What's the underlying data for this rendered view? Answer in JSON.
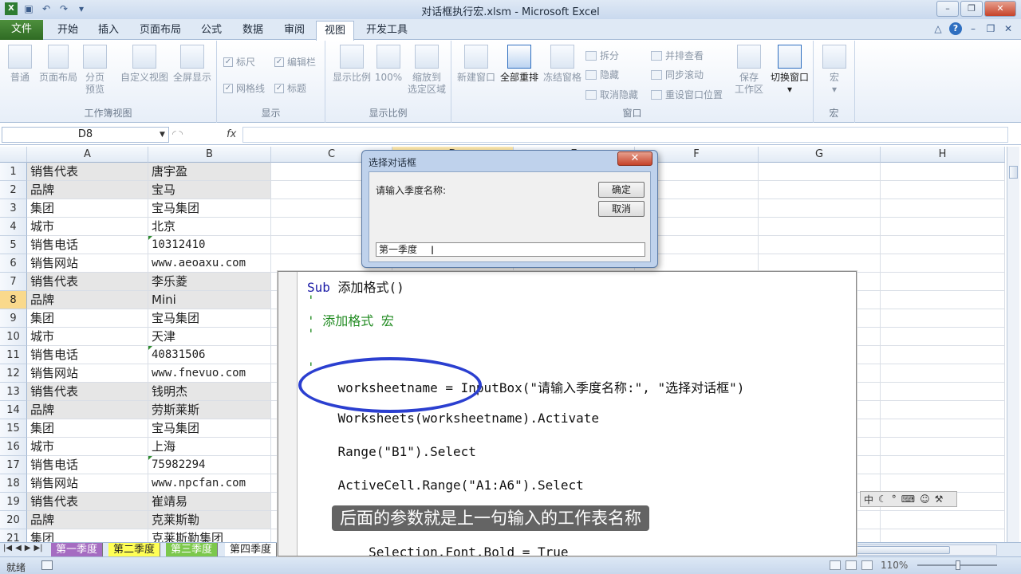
{
  "window": {
    "title": "对话框执行宏.xlsm - Microsoft Excel",
    "qat_icons": [
      "excel-icon",
      "save-icon",
      "undo-icon",
      "redo-icon",
      "customize-icon"
    ]
  },
  "tabs": [
    "文件",
    "开始",
    "插入",
    "页面布局",
    "公式",
    "数据",
    "审阅",
    "视图",
    "开发工具"
  ],
  "ribbon": {
    "workbook_views": {
      "label": "工作簿视图",
      "buttons": [
        "普通",
        "页面布局",
        "分页",
        "预览",
        "自定义视图",
        "全屏显示"
      ]
    },
    "show": {
      "label": "显示",
      "checks": [
        "标尺",
        "编辑栏",
        "网格线",
        "标题"
      ]
    },
    "zoom": {
      "label": "显示比例",
      "buttons": [
        "显示比例",
        "100%",
        "缩放到",
        "选定区域"
      ]
    },
    "window": {
      "label": "窗口",
      "buttons": [
        "新建窗口",
        "全部重排",
        "冻结窗格",
        "保存",
        "工作区",
        "切换窗口"
      ],
      "small": [
        "拆分",
        "隐藏",
        "取消隐藏",
        "并排查看",
        "同步滚动",
        "重设窗口位置"
      ]
    },
    "macros": {
      "label": "宏",
      "button": "宏"
    }
  },
  "formula_bar": {
    "name_box": "D8",
    "fx": "fx",
    "formula": ""
  },
  "columns": [
    "A",
    "B",
    "C",
    "D",
    "E",
    "F",
    "G",
    "H"
  ],
  "rows": [
    {
      "n": "1",
      "a": "销售代表",
      "b": "唐宇盈"
    },
    {
      "n": "2",
      "a": "品牌",
      "b": " 宝马"
    },
    {
      "n": "3",
      "a": "集团",
      "b": "宝马集团"
    },
    {
      "n": "4",
      "a": "城市",
      "b": "北京"
    },
    {
      "n": "5",
      "a": "销售电话",
      "b": "10312410"
    },
    {
      "n": "6",
      "a": "销售网站",
      "b": "www.aeoaxu.com"
    },
    {
      "n": "7",
      "a": "销售代表",
      "b": "李乐菱"
    },
    {
      "n": "8",
      "a": "品牌",
      "b": " Mini"
    },
    {
      "n": "9",
      "a": "集团",
      "b": "宝马集团"
    },
    {
      "n": "10",
      "a": "城市",
      "b": "天津"
    },
    {
      "n": "11",
      "a": "销售电话",
      "b": "40831506"
    },
    {
      "n": "12",
      "a": "销售网站",
      "b": "www.fnevuo.com"
    },
    {
      "n": "13",
      "a": "销售代表",
      "b": "钱明杰"
    },
    {
      "n": "14",
      "a": "品牌",
      "b": " 劳斯莱斯"
    },
    {
      "n": "15",
      "a": "集团",
      "b": "宝马集团"
    },
    {
      "n": "16",
      "a": "城市",
      "b": "上海"
    },
    {
      "n": "17",
      "a": "销售电话",
      "b": "75982294"
    },
    {
      "n": "18",
      "a": "销售网站",
      "b": "www.npcfan.com"
    },
    {
      "n": "19",
      "a": "销售代表",
      "b": "崔靖易"
    },
    {
      "n": "20",
      "a": "品牌",
      "b": " 克莱斯勒"
    },
    {
      "n": "21",
      "a": "集团",
      "b": "克莱斯勒集团"
    }
  ],
  "sheets": [
    "第一季度",
    "第二季度",
    "第三季度",
    "第四季度"
  ],
  "status": {
    "ready": "就绪",
    "zoom": "110%"
  },
  "dialog": {
    "title": "选择对话框",
    "prompt": "请输入季度名称:",
    "ok": "确定",
    "cancel": "取消",
    "input_value": "第一季度"
  },
  "code": {
    "lines": [
      "Sub 添加格式()",
      "'",
      "' 添加格式 宏",
      "'",
      "'",
      "    worksheetname = InputBox(\"请输入季度名称:\", \"选择对话框\")",
      "    Worksheets(worksheetname).Activate",
      "    Range(\"B1\").Select",
      "    ActiveCell.Range(\"A1:A6\").Select",
      "        Selection.Font.Bold = True"
    ]
  },
  "subtitle": "后面的参数就是上一句输入的工作表名称",
  "float_toolbar": [
    "中",
    "moon-icon",
    "dot-icon",
    "keyboard-icon",
    "user-icon",
    "wrench-icon"
  ]
}
